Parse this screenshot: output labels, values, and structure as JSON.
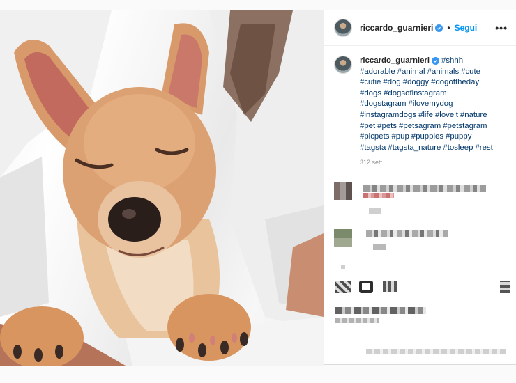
{
  "post": {
    "username": "riccardo_guarnieri",
    "follow_label": "Segui",
    "separator": "•",
    "more_label": "•••",
    "caption": {
      "username": "riccardo_guarnieri",
      "tags": [
        "#shhh",
        "#adorable",
        "#animal",
        "#animals",
        "#cute",
        "#cutie",
        "#dog",
        "#doggy",
        "#dogoftheday",
        "#dogs",
        "#dogsofinstagram",
        "#dogstagram",
        "#ilovemydog",
        "#instagramdogs",
        "#life",
        "#loveit",
        "#nature",
        "#pet",
        "#pets",
        "#petsagram",
        "#petstagram",
        "#picpets",
        "#pup",
        "#puppies",
        "#puppy",
        "#tagsta",
        "#tagsta_nature",
        "#tosleep",
        "#rest"
      ],
      "time": "312 sett"
    },
    "colors": {
      "link": "#00376b",
      "follow": "#0095f6",
      "verified": "#3897f0",
      "muted": "#8e8e8e"
    }
  }
}
